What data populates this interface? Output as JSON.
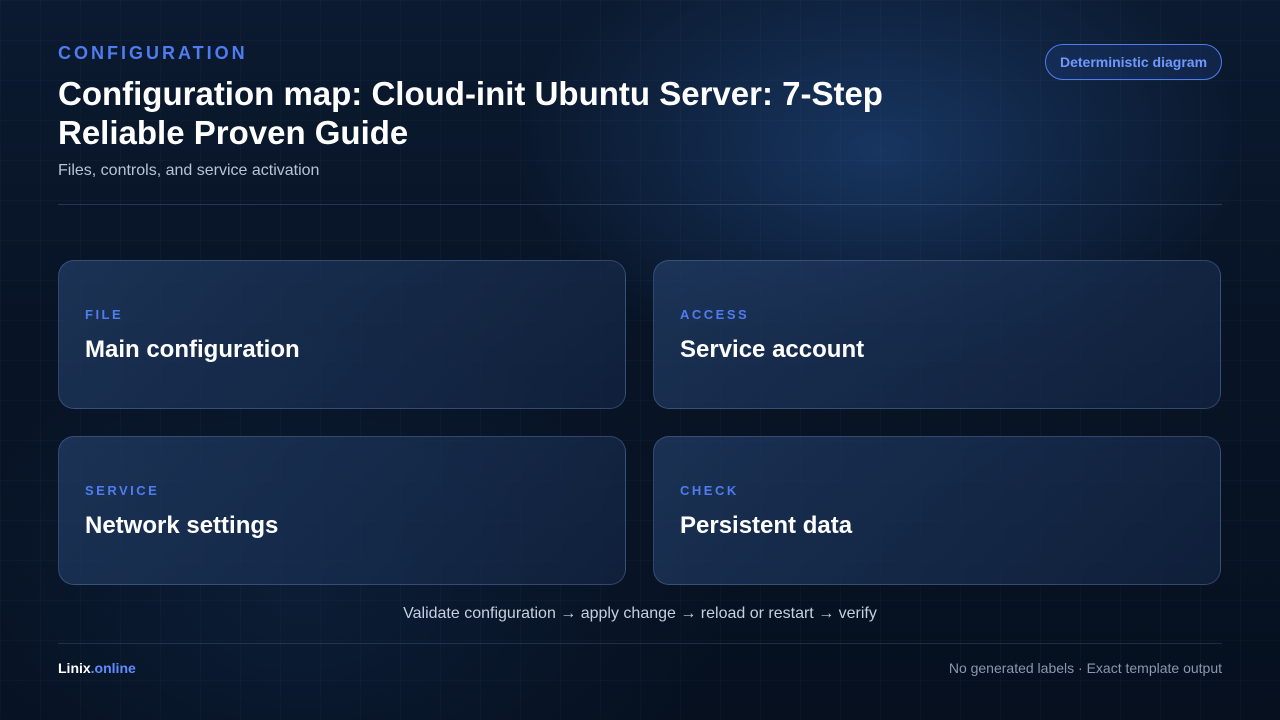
{
  "header": {
    "eyebrow": "CONFIGURATION",
    "title": "Configuration map: Cloud-init Ubuntu Server: 7-Step Reliable Proven Guide",
    "subtitle": "Files, controls, and service activation",
    "badge": "Deterministic diagram"
  },
  "cards": [
    {
      "kicker": "FILE",
      "title": "Main configuration"
    },
    {
      "kicker": "ACCESS",
      "title": "Service account"
    },
    {
      "kicker": "SERVICE",
      "title": "Network settings"
    },
    {
      "kicker": "CHECK",
      "title": "Persistent data"
    }
  ],
  "flow": "Validate configuration → apply change → reload or restart → verify",
  "footer": {
    "brand_name": "Linix",
    "brand_tld": ".online",
    "note": "No generated labels · Exact template output"
  },
  "colors": {
    "accent": "#4f7cf0",
    "background": "#081426",
    "text": "#ffffff"
  }
}
